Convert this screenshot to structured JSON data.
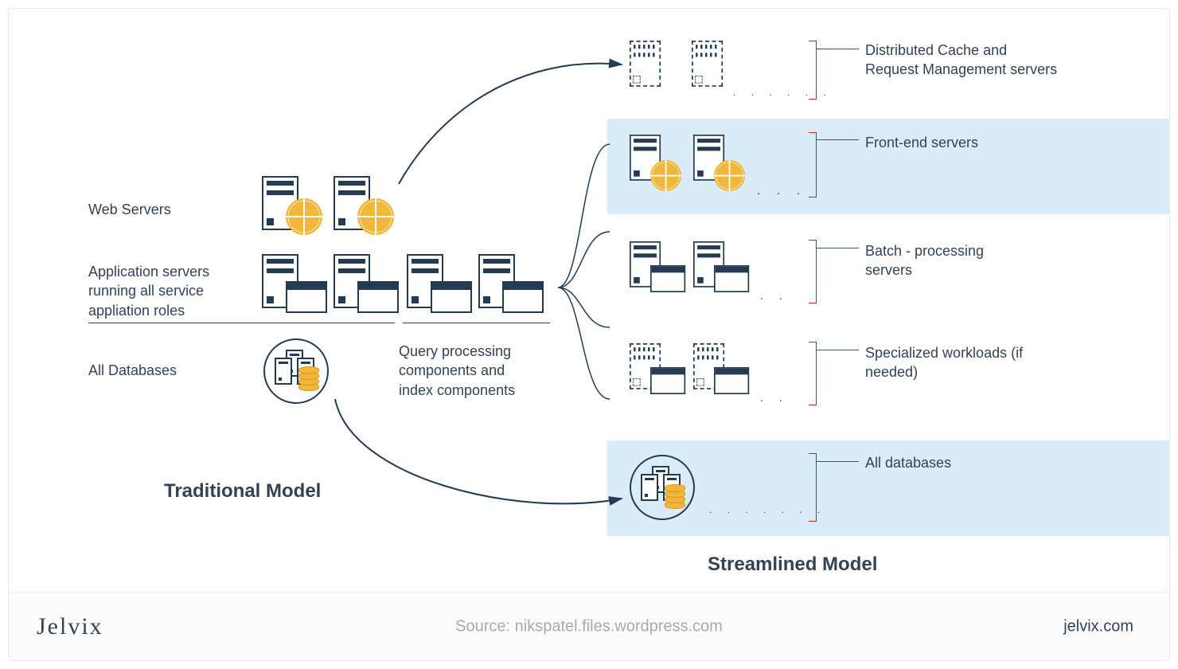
{
  "traditional": {
    "title": "Traditional Model",
    "labels": {
      "web_servers": "Web Servers",
      "app_servers": "Application servers running all service appliation roles",
      "query": "Query processing components and index components",
      "all_db": "All Databases"
    }
  },
  "streamlined": {
    "title": "Streamlined Model",
    "rows": {
      "cache": "Distributed Cache and Request Management servers",
      "frontend": "Front-end servers",
      "batch": "Batch - processing servers",
      "specialized": "Specialized workloads (if needed)",
      "all_db": "All databases"
    }
  },
  "footer": {
    "logo": "Jelvix",
    "source": "Source: nikspatel.files.wordpress.com",
    "site": "jelvix.com"
  }
}
